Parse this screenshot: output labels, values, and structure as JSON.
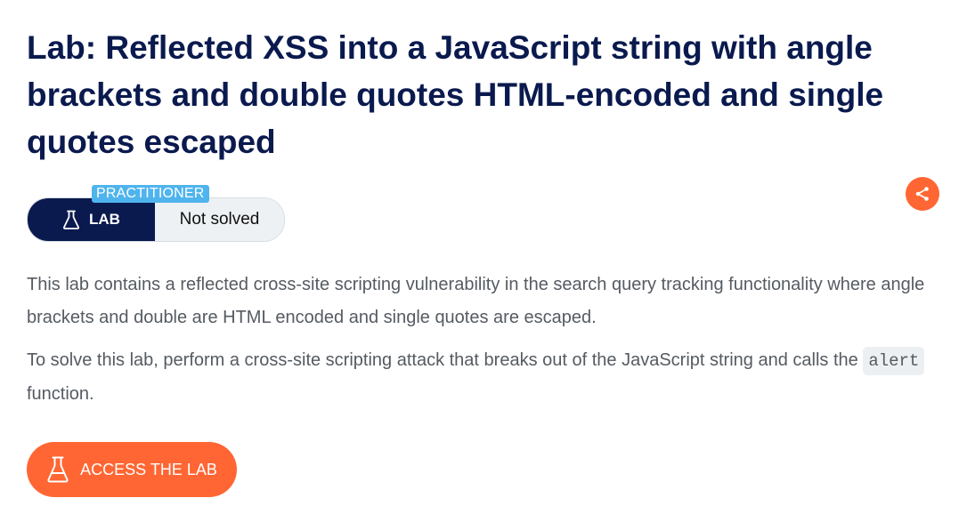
{
  "lab": {
    "title": "Lab: Reflected XSS into a JavaScript string with angle brackets and double quotes HTML-encoded and single quotes escaped",
    "level": "PRACTITIONER",
    "badge_label": "LAB",
    "status": "Not solved"
  },
  "description": {
    "paragraph1": "This lab contains a reflected cross-site scripting vulnerability in the search query tracking functionality where angle brackets and double are HTML encoded and single quotes are escaped.",
    "paragraph2_before": "To solve this lab, perform a cross-site scripting attack that breaks out of the JavaScript string and calls the ",
    "paragraph2_code": "alert",
    "paragraph2_after": " function."
  },
  "actions": {
    "access_label": "ACCESS THE LAB"
  },
  "icons": {
    "share": "share-icon",
    "flask": "flask-icon"
  },
  "colors": {
    "navy": "#0a1a4e",
    "orange": "#ff6633",
    "practitioner_blue": "#4fb4ee"
  }
}
